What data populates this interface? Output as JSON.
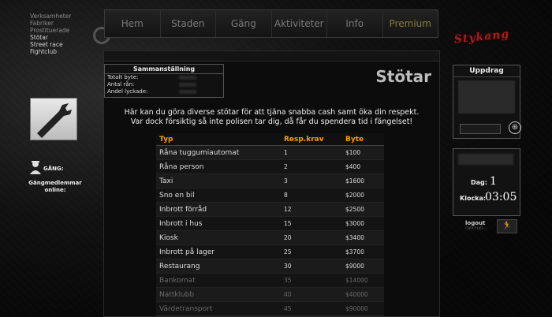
{
  "left_menu": {
    "items": [
      {
        "label": "Verksamheter",
        "dim": true
      },
      {
        "label": "Fabriker",
        "dim": true
      },
      {
        "label": "Prostituerade",
        "dim": true
      },
      {
        "label": "Stötar",
        "dim": false
      },
      {
        "label": "Street race",
        "dim": false
      },
      {
        "label": "Fightclub",
        "dim": false
      }
    ]
  },
  "gang": {
    "label": "GÅNG:",
    "members_label": "Gängmedlemmar online:"
  },
  "nav": {
    "tabs": [
      "Hem",
      "Staden",
      "Gäng",
      "Aktiviteter",
      "Info",
      "Premium"
    ]
  },
  "logo": {
    "text": "Stykang"
  },
  "summary": {
    "title": "Sammanställning",
    "rows": [
      "Totalt byte:",
      "Antal rån:",
      "Andel lyckade:"
    ]
  },
  "page_title": "Stötar",
  "description": {
    "line1": "Här kan du göra diverse stötar för att tjäna snabba cash samt öka din respekt.",
    "line2": "Var dock försiktig så inte polisen tar dig, då får du spendera tid i fängelset!"
  },
  "table": {
    "headers": [
      "Typ",
      "Resp.krav",
      "Byte"
    ],
    "rows": [
      {
        "type": "Råna tuggumiautomat",
        "req": "1",
        "loot": "$100",
        "locked": false
      },
      {
        "type": "Råna person",
        "req": "2",
        "loot": "$400",
        "locked": false
      },
      {
        "type": "Taxi",
        "req": "3",
        "loot": "$1600",
        "locked": false
      },
      {
        "type": "Sno en bil",
        "req": "8",
        "loot": "$2000",
        "locked": false
      },
      {
        "type": "Inbrott förråd",
        "req": "12",
        "loot": "$2500",
        "locked": false
      },
      {
        "type": "Inbrott i hus",
        "req": "15",
        "loot": "$3000",
        "locked": false
      },
      {
        "type": "Kiosk",
        "req": "20",
        "loot": "$3400",
        "locked": false
      },
      {
        "type": "Inbrott på lager",
        "req": "25",
        "loot": "$3700",
        "locked": false
      },
      {
        "type": "Restaurang",
        "req": "30",
        "loot": "$9000",
        "locked": false
      },
      {
        "type": "Bankomat",
        "req": "35",
        "loot": "$14000",
        "locked": true
      },
      {
        "type": "Nattklubb",
        "req": "40",
        "loot": "$40000",
        "locked": true
      },
      {
        "type": "Värdetransport",
        "req": "45",
        "loot": "$90000",
        "locked": true
      }
    ]
  },
  "mission": {
    "title": "Uppdrag"
  },
  "clock": {
    "day_label": "Dag:",
    "day_value": "1",
    "time_label": "Klocka:",
    "time_value": "03:05"
  },
  "logout": {
    "label": "logout",
    "sub": "run run..."
  },
  "colors": {
    "accent": "#ff9a00",
    "logo": "#a81d1d"
  }
}
